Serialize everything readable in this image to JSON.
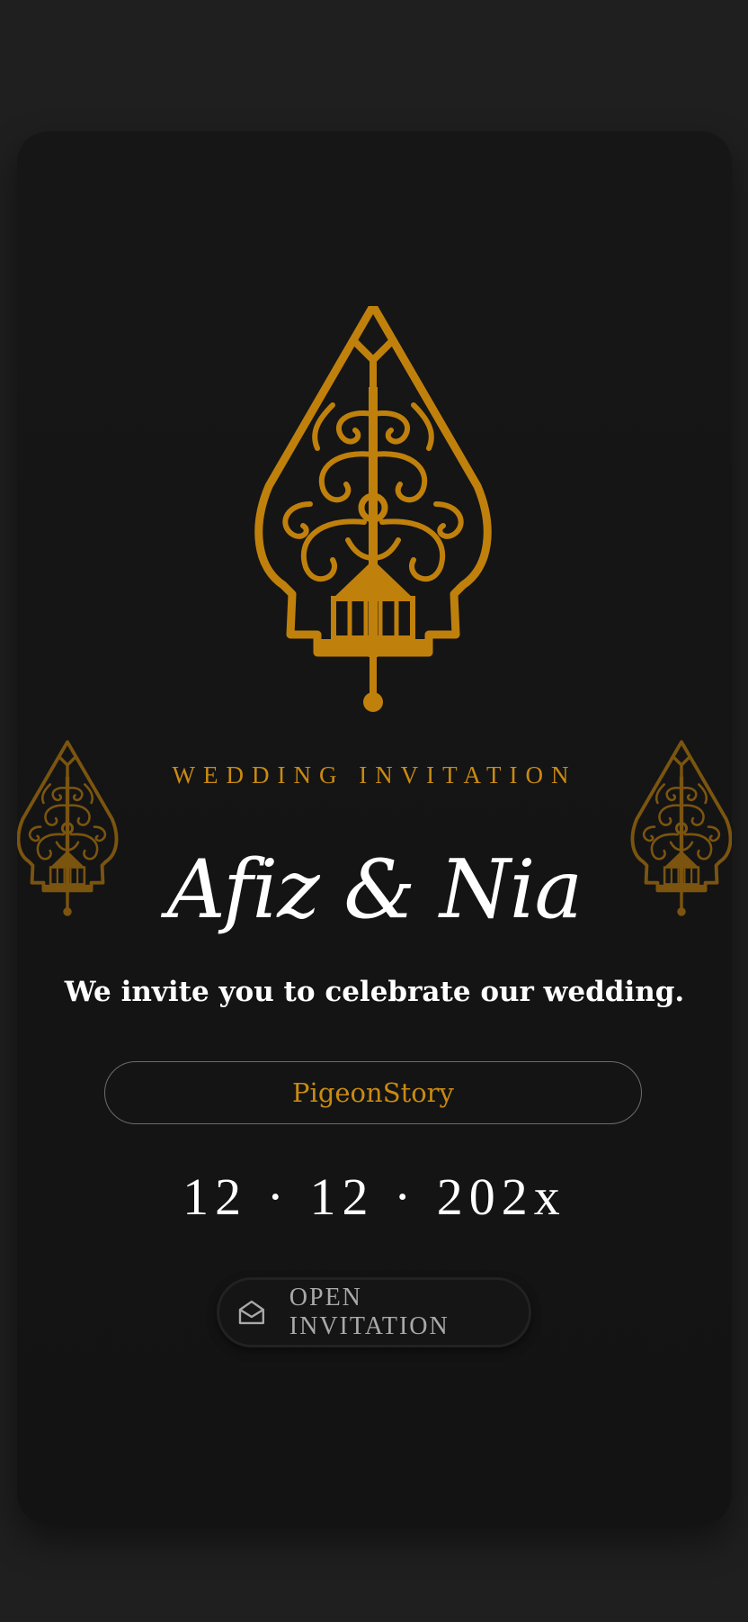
{
  "invitation": {
    "eyebrow": "WEDDING INVITATION",
    "couple": "Afiz & Nia",
    "tagline": "We invite you to celebrate our wedding.",
    "guest_name": "PigeonStory",
    "date": "12 · 12 · 202x",
    "open_button_label": "OPEN INVITATION"
  },
  "icons": {
    "ornament": "gunungan-icon",
    "open_button": "open-envelope-icon"
  },
  "colors": {
    "accent_gold": "#c98a12",
    "background": "#1f1f1f",
    "card": "#141414",
    "text": "#ffffff"
  }
}
